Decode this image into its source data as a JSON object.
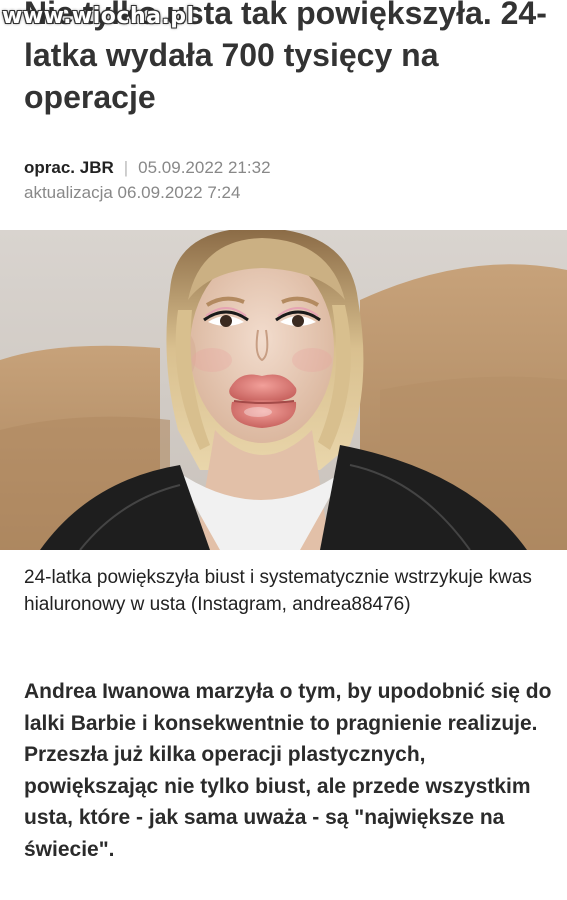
{
  "watermark": "www.wiocha.pl",
  "article": {
    "headline": "Nie tylko usta tak powiększyła. 24-latka wydała 700 tysięcy na operacje",
    "author": "oprac. JBR",
    "separator": "|",
    "published": "05.09.2022 21:32",
    "updated": "aktualizacja 06.09.2022 7:24",
    "caption": "24-latka powiększyła biust i systematycznie wstrzykuje kwas hialuronowy w usta (Instagram, andrea88476)",
    "lead": "Andrea Iwanowa marzyła o tym, by upodobnić się do lalki Barbie i konsekwentnie to pragnienie realizuje. Przeszła już kilka operacji plastycznych, powiększając nie tylko biust, ale przede wszystkim usta, które - jak sama uważa - są \"największe na świecie\"."
  }
}
